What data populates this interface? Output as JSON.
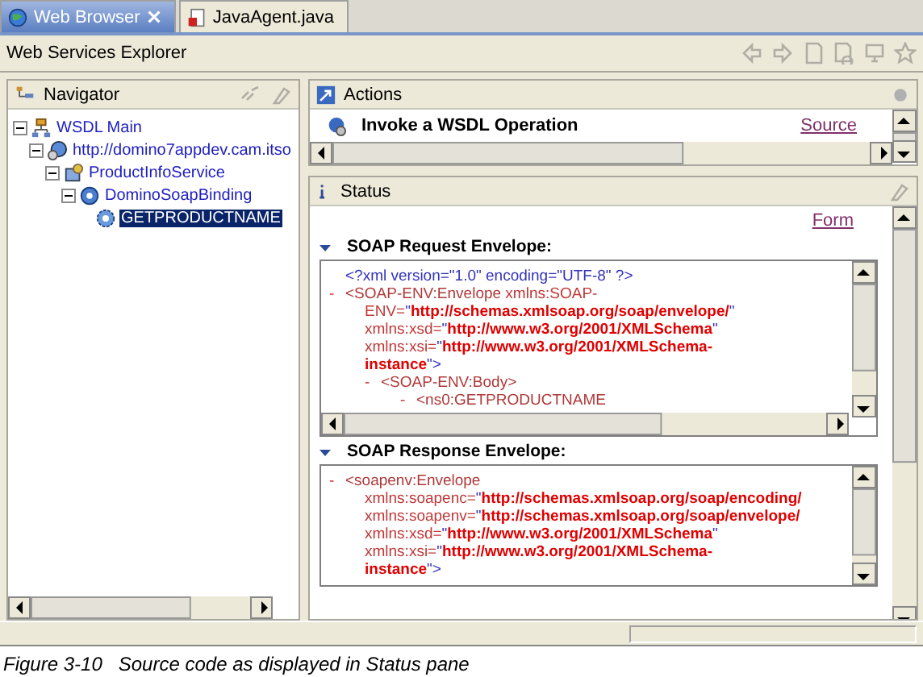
{
  "tabs": [
    {
      "label": "Web Browser",
      "selected": true,
      "kind": "browser"
    },
    {
      "label": "JavaAgent.java",
      "selected": false,
      "kind": "java"
    }
  ],
  "window": {
    "title": "Web Services Explorer"
  },
  "navigator": {
    "title": "Navigator",
    "tree": [
      {
        "label": "WSDL Main",
        "kind": "root",
        "selected": false,
        "expanded": true,
        "children": [
          {
            "label": "http://domino7appdev.cam.itso",
            "kind": "wsdl",
            "selected": false,
            "expanded": true,
            "children": [
              {
                "label": "ProductInfoService",
                "kind": "service",
                "selected": false,
                "expanded": true,
                "children": [
                  {
                    "label": "DominoSoapBinding",
                    "kind": "binding",
                    "selected": false,
                    "expanded": true,
                    "children": [
                      {
                        "label": "GETPRODUCTNAME",
                        "kind": "operation",
                        "selected": true
                      }
                    ]
                  }
                ]
              }
            ]
          }
        ]
      }
    ]
  },
  "actions": {
    "title": "Actions",
    "heading": "Invoke a WSDL Operation",
    "link": "Source"
  },
  "status": {
    "title": "Status",
    "link": "Form",
    "sections": [
      {
        "title": "SOAP Request Envelope:",
        "expanded": true,
        "nodes": [
          {
            "lines": [
              [
                {
                  "kind": "pi",
                  "text": "<?xml version=\"1.0\" encoding=\"UTF-8\" ?>"
                }
              ]
            ]
          },
          {
            "toggle": "-",
            "lines": [
              [
                {
                  "kind": "tag",
                  "text": "<SOAP-ENV:Envelope"
                },
                {
                  "kind": "attr",
                  "text": " xmlns:SOAP-"
                }
              ],
              [
                {
                  "kind": "attr",
                  "text": "ENV="
                },
                {
                  "kind": "quote",
                  "text": "\""
                },
                {
                  "kind": "value",
                  "text": "http://schemas.xmlsoap.org/soap/envelope/"
                },
                {
                  "kind": "quote",
                  "text": "\""
                }
              ],
              [
                {
                  "kind": "attr",
                  "text": "xmlns:xsd="
                },
                {
                  "kind": "quote",
                  "text": "\""
                },
                {
                  "kind": "value",
                  "text": "http://www.w3.org/2001/XMLSchema"
                },
                {
                  "kind": "quote",
                  "text": "\""
                }
              ],
              [
                {
                  "kind": "attr",
                  "text": "xmlns:xsi="
                },
                {
                  "kind": "quote",
                  "text": "\""
                },
                {
                  "kind": "value",
                  "text": "http://www.w3.org/2001/XMLSchema-"
                }
              ],
              [
                {
                  "kind": "value",
                  "text": "instance"
                },
                {
                  "kind": "quote",
                  "text": "\">"
                }
              ]
            ],
            "children": [
              {
                "toggle": "-",
                "lines": [
                  [
                    {
                      "kind": "tag",
                      "text": "<SOAP-ENV:Body>"
                    }
                  ]
                ],
                "children": [
                  {
                    "toggle": "-",
                    "lines": [
                      [
                        {
                          "kind": "tag",
                          "text": "<ns0:GETPRODUCTNAME"
                        }
                      ]
                    ]
                  }
                ]
              }
            ]
          }
        ]
      },
      {
        "title": "SOAP Response Envelope:",
        "expanded": true,
        "nodes": [
          {
            "toggle": "-",
            "lines": [
              [
                {
                  "kind": "tag",
                  "text": "<soapenv:Envelope"
                }
              ],
              [
                {
                  "kind": "attr",
                  "text": "xmlns:soapenc="
                },
                {
                  "kind": "quote",
                  "text": "\""
                },
                {
                  "kind": "value",
                  "text": "http://schemas.xmlsoap.org/soap/encoding/"
                }
              ],
              [
                {
                  "kind": "attr",
                  "text": "xmlns:soapenv="
                },
                {
                  "kind": "quote",
                  "text": "\""
                },
                {
                  "kind": "value",
                  "text": "http://schemas.xmlsoap.org/soap/envelope/"
                }
              ],
              [
                {
                  "kind": "attr",
                  "text": "xmlns:xsd="
                },
                {
                  "kind": "quote",
                  "text": "\""
                },
                {
                  "kind": "value",
                  "text": "http://www.w3.org/2001/XMLSchema"
                },
                {
                  "kind": "quote",
                  "text": "\""
                }
              ],
              [
                {
                  "kind": "attr",
                  "text": "xmlns:xsi="
                },
                {
                  "kind": "quote",
                  "text": "\""
                },
                {
                  "kind": "value",
                  "text": "http://www.w3.org/2001/XMLSchema-"
                }
              ],
              [
                {
                  "kind": "value",
                  "text": "instance"
                },
                {
                  "kind": "quote",
                  "text": "\">"
                }
              ]
            ]
          }
        ]
      }
    ]
  },
  "caption": "Figure 3-10   Source code as displayed in Status pane"
}
